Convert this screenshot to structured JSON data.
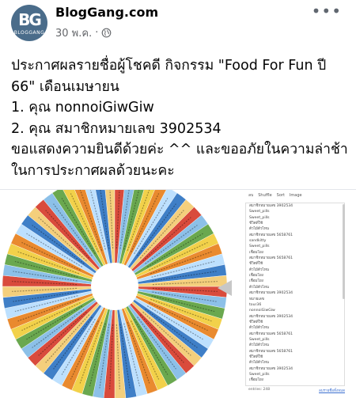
{
  "header": {
    "page_name": "BlogGang.com",
    "date": "30 พ.ค.",
    "separator": "·",
    "logo_text": "BG",
    "logo_tagline": "BLOGGANG",
    "more_label": "•••"
  },
  "post": {
    "lines": [
      "ประกาศผลรายชื่อผู้โชคดี กิจกรรม \"Food For Fun ปี",
      "66\" เดือนเมษายน",
      "1. คุณ nonnoiGiwGiw",
      "2. คุณ สมาชิกหมายเลข 3902534",
      "ขอแสดงความยินดีด้วยค่ะ ^^ และขออภัยในความล่าช้า",
      "ในการประกาศผลด้วยนะคะ"
    ]
  },
  "wheel_panel": {
    "toolbar": [
      "ลบ",
      "Shuffle",
      "Sort",
      "Image"
    ],
    "entries": [
      "สมาชิกหมายเลข 3902534",
      "Sweet_pills",
      "Sweet_pills",
      "ชีวิตที่ใช้",
      "ตัวไม้ตัวไหน",
      "สมาชิกหมายเลข 5658761",
      "sandkitty",
      "Sweet_pills",
      "เชื่อมโยง",
      "สมาชิกหมายเลข 5658761",
      "ชีวิตที่ใช้",
      "ตัวไม้ตัวไหน",
      "เชื่อมโยง",
      "เชื่อมโยง",
      "ตัวไม้ตัวไหน",
      "สมาชิกหมายเลข 3902534",
      "หมายเลข",
      "tour36",
      "nonnoiGiwGiw",
      "สมาชิกหมายเลข 3902534",
      "ชีวิตที่ใช้",
      "ตัวไม้ตัวไหน",
      "สมาชิกหมายเลข 5658761",
      "Sweet_pills",
      "ตัวไม้ตัวไหน",
      "สมาชิกหมายเลข 5658761",
      "ชีวิตที่ใช้",
      "ตัวไม้ตัวไหน",
      "สมาชิกหมายเลข 3902534",
      "Sweet_pills",
      "เชื่อมโยง"
    ],
    "footer_left": "entries: 248",
    "footer_right": "ลบรายชื่อทั้งหมด"
  },
  "wheel": {
    "colors": [
      "#d94b3c",
      "#f2d14a",
      "#3f7fc7",
      "#8cc0e8",
      "#e98a2f",
      "#f4cf7c",
      "#6aa84f",
      "#bde0fe"
    ],
    "hub_color": "#ffffff",
    "pointer_color": "#c7c7c7"
  }
}
